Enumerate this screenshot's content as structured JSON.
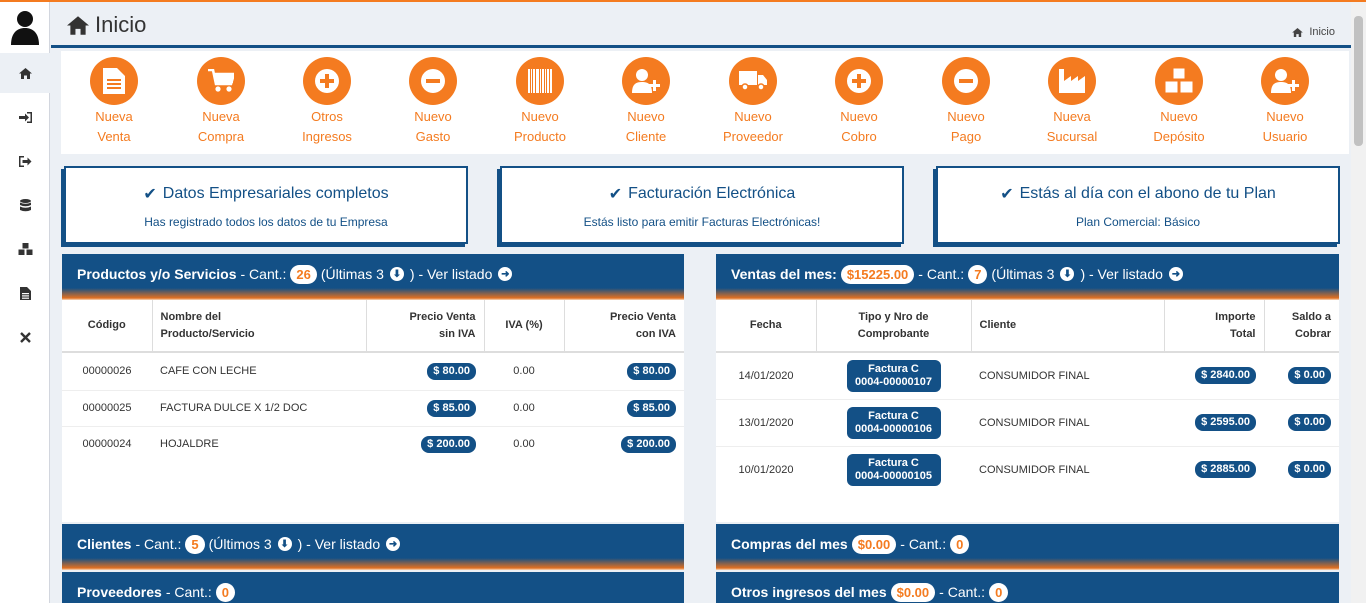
{
  "page": {
    "title": "Inicio",
    "breadcrumb": "Inicio"
  },
  "quick_actions": [
    {
      "l1": "Nueva",
      "l2": "Venta",
      "icon": "file-text-icon"
    },
    {
      "l1": "Nueva",
      "l2": "Compra",
      "icon": "cart-icon"
    },
    {
      "l1": "Otros",
      "l2": "Ingresos",
      "icon": "plus-circle-icon"
    },
    {
      "l1": "Nuevo",
      "l2": "Gasto",
      "icon": "minus-circle-icon"
    },
    {
      "l1": "Nuevo",
      "l2": "Producto",
      "icon": "barcode-icon"
    },
    {
      "l1": "Nuevo",
      "l2": "Cliente",
      "icon": "user-plus-icon"
    },
    {
      "l1": "Nuevo",
      "l2": "Proveedor",
      "icon": "truck-icon"
    },
    {
      "l1": "Nuevo",
      "l2": "Cobro",
      "icon": "plus-circle-icon"
    },
    {
      "l1": "Nuevo",
      "l2": "Pago",
      "icon": "minus-circle-icon"
    },
    {
      "l1": "Nueva",
      "l2": "Sucursal",
      "icon": "industry-icon"
    },
    {
      "l1": "Nuevo",
      "l2": "Depósito",
      "icon": "cubes-icon"
    },
    {
      "l1": "Nuevo",
      "l2": "Usuario",
      "icon": "user-plus-icon"
    }
  ],
  "status_cards": [
    {
      "title": "Datos Empresariales completos",
      "sub": "Has registrado todos los datos de tu Empresa"
    },
    {
      "title": "Facturación Electrónica",
      "sub": "Estás listo para emitir Facturas Electrónicas!"
    },
    {
      "title": "Estás al día con el abono de tu Plan",
      "sub": "Plan Comercial: Básico"
    }
  ],
  "productos": {
    "title": "Productos y/o Servicios",
    "cant_label": "- Cant.:",
    "count": "26",
    "ultimas": "(Últimas 3",
    "ver": ") - Ver listado",
    "headers": [
      "Código",
      "Nombre del Producto/Servicio",
      "Precio Venta sin IVA",
      "IVA (%)",
      "Precio Venta con IVA"
    ],
    "h_lines": [
      [
        "Código"
      ],
      [
        "Nombre del",
        "Producto/Servicio"
      ],
      [
        "Precio Venta",
        "sin IVA"
      ],
      [
        "IVA (%)"
      ],
      [
        "Precio Venta",
        "con IVA"
      ]
    ],
    "rows": [
      {
        "codigo": "00000026",
        "nombre": "CAFE CON LECHE",
        "sin_iva": "$ 80.00",
        "iva": "0.00",
        "con_iva": "$ 80.00"
      },
      {
        "codigo": "00000025",
        "nombre": "FACTURA DULCE X 1/2 DOC",
        "sin_iva": "$ 85.00",
        "iva": "0.00",
        "con_iva": "$ 85.00"
      },
      {
        "codigo": "00000024",
        "nombre": "HOJALDRE",
        "sin_iva": "$ 200.00",
        "iva": "0.00",
        "con_iva": "$ 200.00"
      }
    ]
  },
  "ventas": {
    "title": "Ventas del mes:",
    "total": "$15225.00",
    "cant_label": "- Cant.:",
    "count": "7",
    "ultimas": "(Últimas 3",
    "ver": ") - Ver listado",
    "h_lines": [
      [
        "Fecha"
      ],
      [
        "Tipo y Nro de",
        "Comprobante"
      ],
      [
        "Cliente"
      ],
      [
        "Importe",
        "Total"
      ],
      [
        "Saldo a",
        "Cobrar"
      ]
    ],
    "rows": [
      {
        "fecha": "14/01/2020",
        "tipo": "Factura C",
        "nro": "0004-00000107",
        "cliente": "CONSUMIDOR FINAL",
        "importe": "$ 2840.00",
        "saldo": "$ 0.00"
      },
      {
        "fecha": "13/01/2020",
        "tipo": "Factura C",
        "nro": "0004-00000106",
        "cliente": "CONSUMIDOR FINAL",
        "importe": "$ 2595.00",
        "saldo": "$ 0.00"
      },
      {
        "fecha": "10/01/2020",
        "tipo": "Factura C",
        "nro": "0004-00000105",
        "cliente": "CONSUMIDOR FINAL",
        "importe": "$ 2885.00",
        "saldo": "$ 0.00"
      }
    ]
  },
  "clientes": {
    "title": "Clientes",
    "cant_label": "- Cant.:",
    "count": "5",
    "ultimas": "(Últimos 3",
    "ver": ") - Ver listado"
  },
  "compras": {
    "title": "Compras del mes",
    "total": "$0.00",
    "cant_label": "- Cant.:",
    "count": "0"
  },
  "proveedores": {
    "title": "Proveedores",
    "cant_label": "- Cant.:",
    "count": "0"
  },
  "otros_ingresos": {
    "title": "Otros ingresos del mes",
    "total": "$0.00",
    "cant_label": "- Cant.:",
    "count": "0"
  },
  "colors": {
    "accent": "#f47b20",
    "primary": "#135086",
    "background": "#ecf0f5"
  }
}
